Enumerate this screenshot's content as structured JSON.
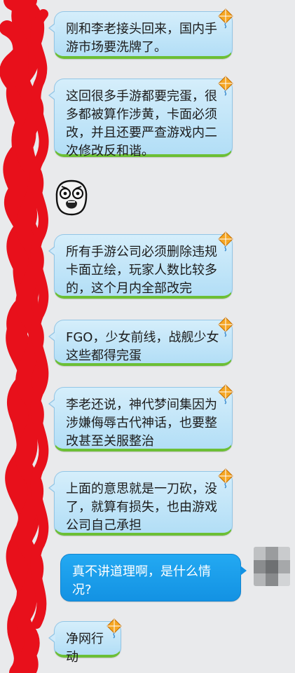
{
  "messages": [
    {
      "side": "in",
      "text": "刚和李老接头回来，国内手\n游市场要洗牌了。"
    },
    {
      "side": "in",
      "text": "这回很多手游都要完蛋，很\n多都被算作涉黄，卡面必须\n改，并且还要严查游戏内二\n次修改反和谐。"
    },
    {
      "side": "in",
      "text": "所有手游公司必须删除违规\n卡面立绘，玩家人数比较多\n的，这个月内全部改完"
    },
    {
      "side": "in",
      "text": "FGO，少女前线，战舰少女\n这些都得完蛋"
    },
    {
      "side": "in",
      "text": "李老还说，神代梦间集因为\n涉嫌侮辱古代神话，也要整\n改甚至关服整治"
    },
    {
      "side": "in",
      "text": "上面的意思就是一刀砍，没\n了，就算有损失，也由游戏\n公司自己承担"
    },
    {
      "side": "out",
      "text": "真不讲道理啊，是什么情\n况?"
    },
    {
      "side": "in",
      "text": "净网行动"
    }
  ],
  "colors": {
    "incoming_bubble": "#c4e6f9",
    "outgoing_bubble": "#1a9eeb",
    "bubble_underline": "#6cbf35",
    "redaction": "#e8101b",
    "background": "#e9eaec"
  },
  "icons": {
    "sticker": "scared-face-sticker",
    "bubble_badge": "kite-icon",
    "avatar": "pixelated-avatar"
  }
}
